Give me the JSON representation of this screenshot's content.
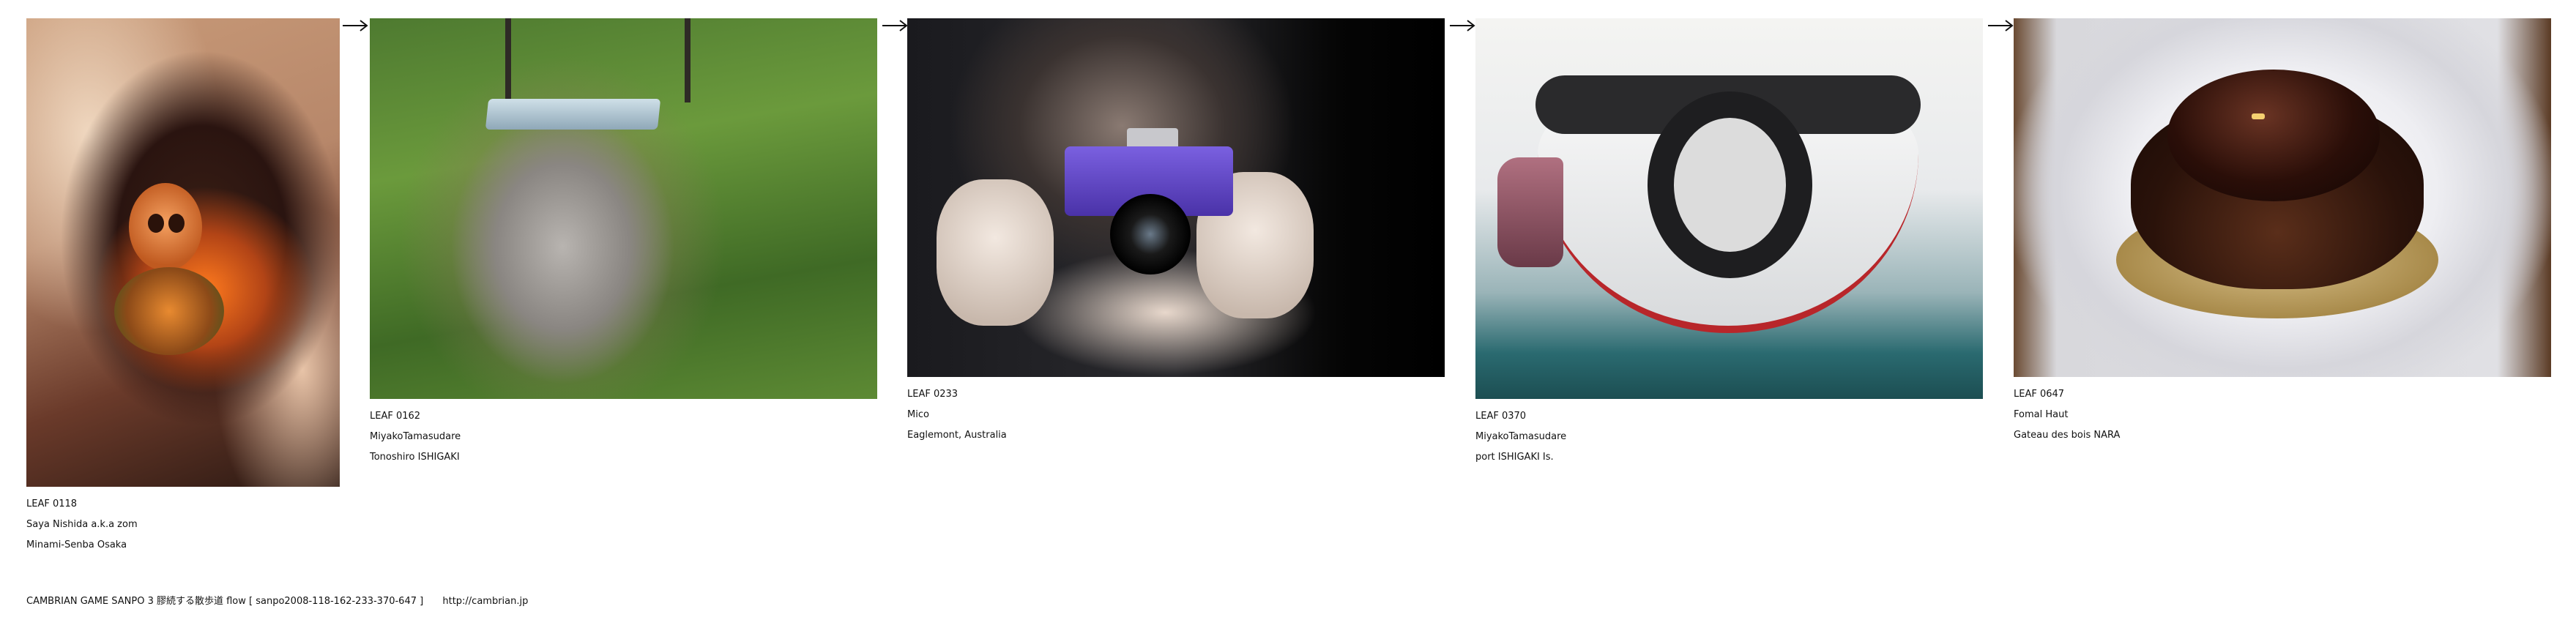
{
  "leaves": [
    {
      "id": "LEAF 0118",
      "author": "Saya Nishida a.k.a zom",
      "place": "Minami-Senba Osaka"
    },
    {
      "id": "LEAF 0162",
      "author": "MiyakoTamasudare",
      "place": "Tonoshiro ISHIGAKI"
    },
    {
      "id": "LEAF 0233",
      "author": "Mico",
      "place": "Eaglemont, Australia"
    },
    {
      "id": "LEAF 0370",
      "author": "MiyakoTamasudare",
      "place": "port ISHIGAKI Is."
    },
    {
      "id": "LEAF 0647",
      "author": "Fomal Haut",
      "place": "Gateau des bois NARA"
    }
  ],
  "footer": {
    "text": "CAMBRIAN GAME  SANPO 3 膠続する散歩道 flow [ sanpo2008-118-162-233-370-647 ]",
    "url": "http://cambrian.jp"
  },
  "icons": {
    "arrow": "right-arrow-icon"
  },
  "colors": {
    "text": "#111111",
    "background": "#ffffff"
  }
}
